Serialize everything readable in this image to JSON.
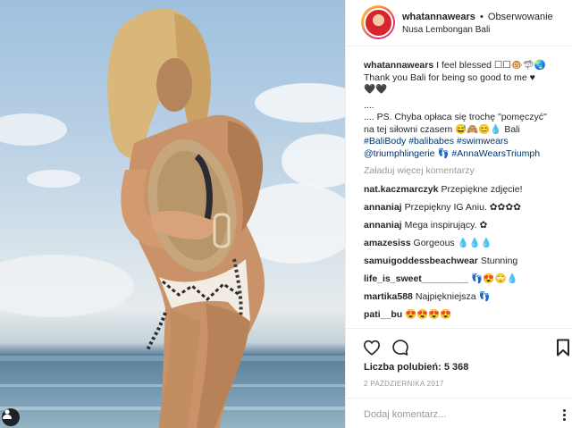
{
  "header": {
    "username": "whatannawears",
    "separator": "•",
    "follow_label": "Obserwowanie",
    "location": "Nusa Lembongan Bali"
  },
  "caption": {
    "username": "whatannawears",
    "line1": "I feel blessed ☐☐🐵🦈🌏",
    "line2": "Thank you Bali for being so good to me ♥",
    "line3": "🖤🖤",
    "line4": "....",
    "line5": ".... PS. Chyba opłaca się trochę \"pomęczyć\"",
    "line6": "na tej siłowni czasem 😅🙈😊💧 Bali",
    "hashtags_line1": "#BaliBody #balibabes #swimwears",
    "hashtags_line2": "@triumphlingerie 👣 #AnnaWearsTriumph"
  },
  "load_more_label": "Załaduj więcej komentarzy",
  "comments": [
    {
      "user": "nat.kaczmarczyk",
      "text": "Przepiękne zdjęcie!"
    },
    {
      "user": "annaniaj",
      "text": "Przepiękny IG Aniu. ✿✿✿✿"
    },
    {
      "user": "annaniaj",
      "text": "Mega inspirujący. ✿"
    },
    {
      "user": "amazesiss",
      "text": "Gorgeous 💧💧💧"
    },
    {
      "user": "samuigoddessbeachwear",
      "text": "Stunning"
    },
    {
      "user": "life_is_sweet_________",
      "text": "👣😍🙄💧"
    },
    {
      "user": "martika588",
      "text": "Najpiękniejsza 👣"
    },
    {
      "user": "pati__bu",
      "text": "😍😍😍😍"
    }
  ],
  "icons": {
    "like": "heart-icon",
    "comment": "speech-bubble-icon",
    "save": "bookmark-icon",
    "options": "vertical-dots-icon",
    "user_tag": "person-icon"
  },
  "likes": {
    "label": "Liczba polubień:",
    "count": "5 368"
  },
  "date": "2 PAŹDZIERNIKA 2017",
  "add_comment": {
    "placeholder": "Dodaj komentarz..."
  },
  "colors": {
    "link": "#003569",
    "muted": "#999999",
    "text": "#262626",
    "border": "#efefef"
  }
}
